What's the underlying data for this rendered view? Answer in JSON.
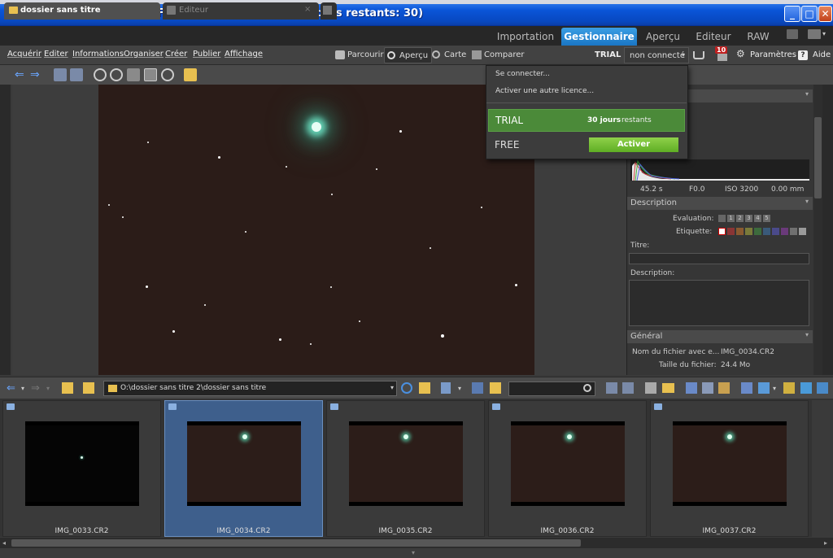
{
  "window": {
    "title": "Zoner Photo Studio 16 Fr TRIAL (version d'essai, jours restants: 30)",
    "minimize": "_",
    "maximize": "□",
    "close": "✕"
  },
  "tabs": {
    "doc1": "dossier sans titre",
    "doc2": "Editeur",
    "doc2_close": "×"
  },
  "modes": [
    "Importation",
    "Gestionnaire",
    "Aperçu",
    "Editeur",
    "RAW"
  ],
  "menu": [
    "Acquérir",
    "Editer",
    "Informations",
    "Organiser",
    "Créer",
    "Publier",
    "Affichage"
  ],
  "viewbuttons": {
    "parcourir": "Parcourir",
    "apercu": "Aperçu",
    "carte": "Carte",
    "comparer": "Comparer"
  },
  "right_tools": {
    "trial": "TRIAL",
    "account": "non connecté",
    "badge": "10",
    "parametres": "Paramètres",
    "aide": "Aide"
  },
  "popup": {
    "connect": "Se connecter...",
    "activate_other": "Activer une autre licence...",
    "trial_label": "TRIAL",
    "trial_days": "30 jours",
    "trial_days_suffix": "restants",
    "free_label": "FREE",
    "activate_btn": "Activer"
  },
  "histogram": {
    "exposure": "45.2 s",
    "aperture": "F0.0",
    "iso": "ISO 3200",
    "focal": "0.00 mm"
  },
  "description": {
    "header": "Description",
    "evaluation_label": "Evaluation:",
    "rating_numbers": [
      "1",
      "2",
      "3",
      "4",
      "5"
    ],
    "etiquette_label": "Etiquette:",
    "etiquette_colors": [
      "#8a3535",
      "#8a5a30",
      "#7a7a3a",
      "#3d6b3d",
      "#3a5a7a",
      "#4a4a8a",
      "#6a3a7a",
      "#707070",
      "#9a9a9a"
    ],
    "titre_label": "Titre:",
    "description_label": "Description:"
  },
  "general": {
    "header": "Général",
    "filename_label": "Nom du fichier avec e...",
    "filename_value": "IMG_0034.CR2",
    "size_label": "Taille du fichier:",
    "size_value": "24.4 Mo"
  },
  "browser": {
    "path": "O:\\dossier sans titre 2\\dossier sans titre"
  },
  "thumbnails": [
    {
      "name": "IMG_0033.CR2",
      "selected": false
    },
    {
      "name": "IMG_0034.CR2",
      "selected": true
    },
    {
      "name": "IMG_0035.CR2",
      "selected": false
    },
    {
      "name": "IMG_0036.CR2",
      "selected": false
    },
    {
      "name": "IMG_0037.CR2",
      "selected": false
    }
  ]
}
